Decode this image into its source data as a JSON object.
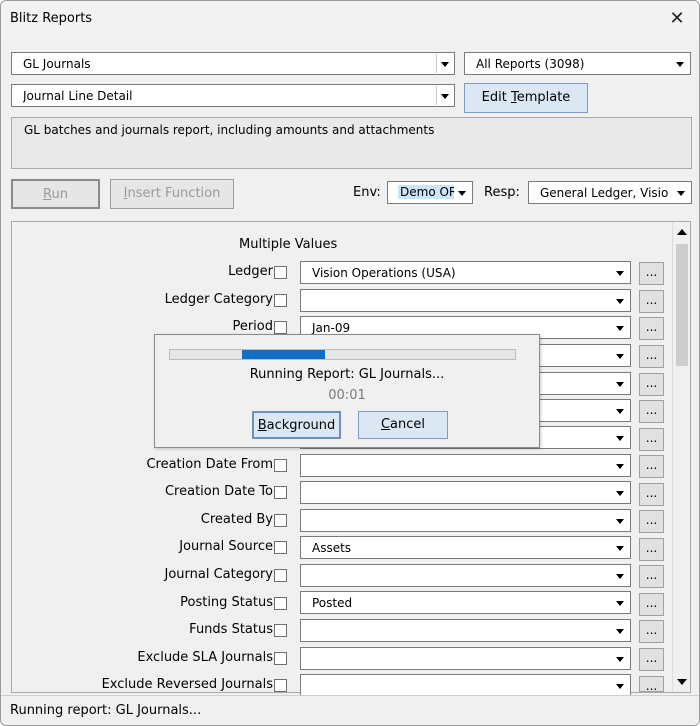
{
  "window": {
    "title": "Blitz Reports"
  },
  "report_select": {
    "value": "GL Journals"
  },
  "category_select": {
    "value": "All Reports (3098)"
  },
  "template_select": {
    "value": "Journal Line Detail"
  },
  "edit_template_button": {
    "label_pre": "Edit ",
    "label_u": "T",
    "label_post": "emplate"
  },
  "description": "GL batches and journals report, including amounts and attachments",
  "run_button": {
    "label_u": "R",
    "label_post": "un"
  },
  "insert_function_button": {
    "label_u": "I",
    "label_post": "nsert Function"
  },
  "env": {
    "label": "Env:",
    "value": "Demo OR"
  },
  "resp": {
    "label": "Resp:",
    "value": "General Ledger, Vision Op"
  },
  "parameters": {
    "header": "Multiple Values",
    "items": [
      {
        "label": "Ledger",
        "value": "Vision Operations (USA)",
        "dots": "..."
      },
      {
        "label": "Ledger Category",
        "value": "",
        "dots": "..."
      },
      {
        "label": "Period",
        "value": "Jan-09",
        "dots": "..."
      },
      {
        "label": "",
        "value": "",
        "dots": "..."
      },
      {
        "label": "",
        "value": "",
        "dots": "..."
      },
      {
        "label": "",
        "value": "",
        "dots": "..."
      },
      {
        "label": "",
        "value": "",
        "dots": "..."
      },
      {
        "label": "Creation Date From",
        "value": "",
        "dots": "..."
      },
      {
        "label": "Creation Date To",
        "value": "",
        "dots": "..."
      },
      {
        "label": "Created By",
        "value": "",
        "dots": "..."
      },
      {
        "label": "Journal Source",
        "value": "Assets",
        "dots": "..."
      },
      {
        "label": "Journal Category",
        "value": "",
        "dots": "..."
      },
      {
        "label": "Posting Status",
        "value": "Posted",
        "dots": "..."
      },
      {
        "label": "Funds Status",
        "value": "",
        "dots": "..."
      },
      {
        "label": "Exclude SLA Journals",
        "value": "",
        "dots": "..."
      },
      {
        "label": "Exclude Reversed Journals",
        "value": "",
        "dots": "..."
      }
    ]
  },
  "progress_dialog": {
    "progress_start": 0.21,
    "progress_end": 0.45,
    "message": "Running Report: GL Journals...",
    "elapsed": "00:01",
    "background_button": {
      "label_u": "B",
      "label_post": "ackground"
    },
    "cancel_button": {
      "label_u": "C",
      "label_post": "ancel"
    }
  },
  "status_bar": "Running report: GL Journals...",
  "colors": {
    "progress": "#0f6fc6",
    "selection": "#cce4f7"
  }
}
